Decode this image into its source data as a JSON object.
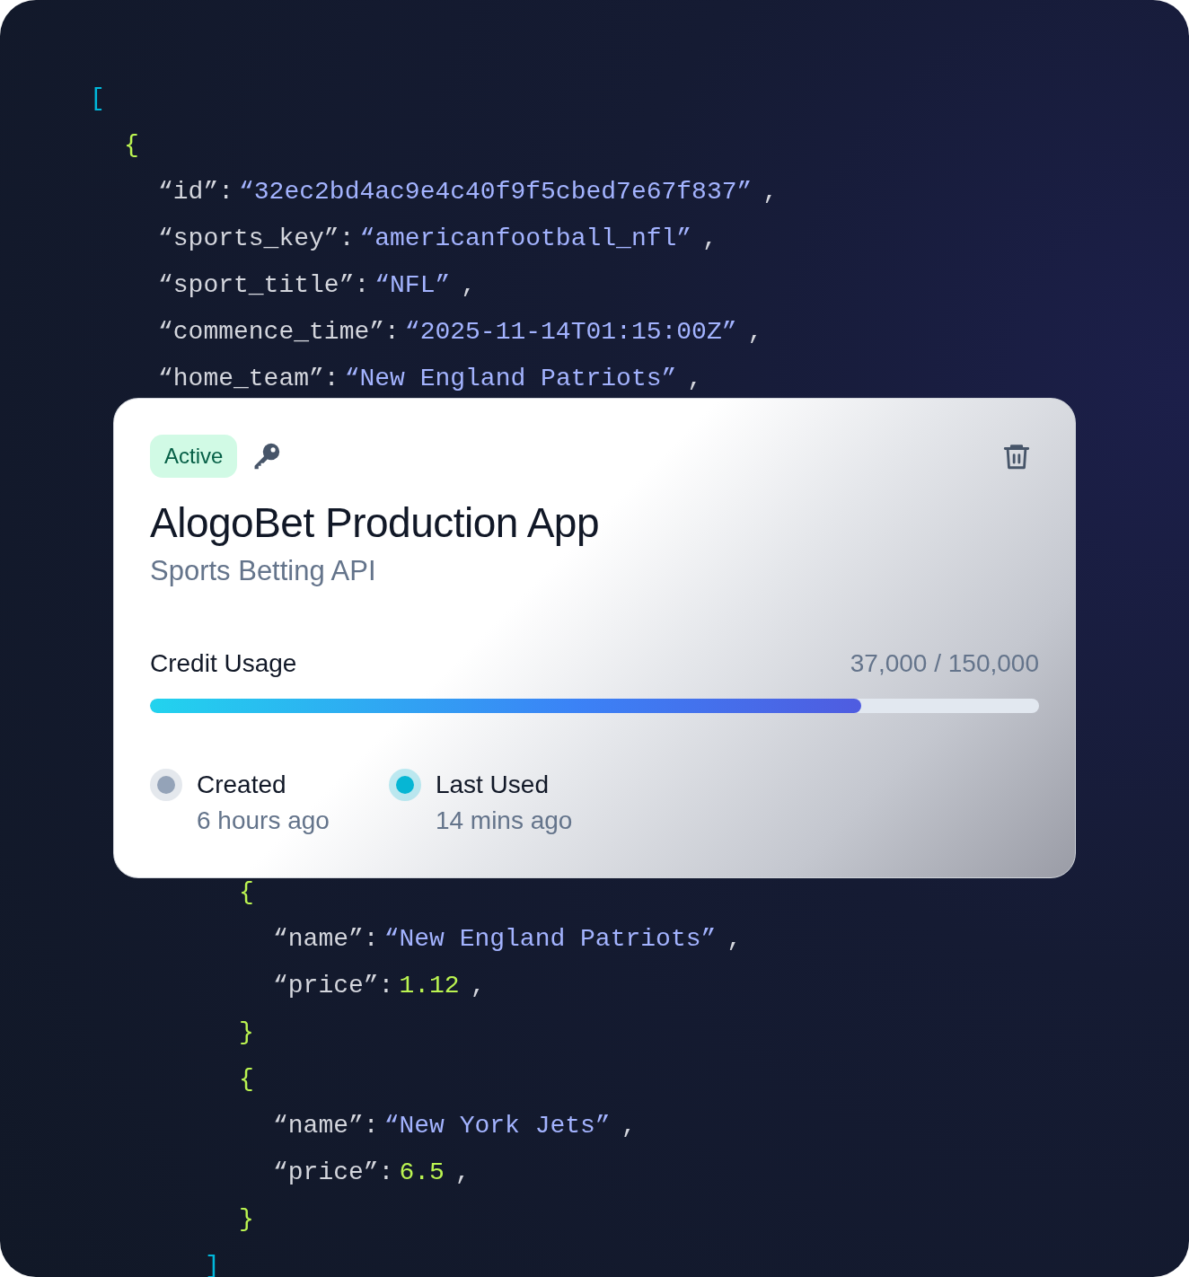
{
  "code_top": [
    {
      "kind": "open_bracket",
      "text": "["
    },
    {
      "kind": "open_brace",
      "text": "{"
    },
    {
      "kind": "field",
      "key": "“id”:",
      "value": {
        "kind": "string",
        "text": "“32ec2bd4ac9e4c40f9f5cbed7e67f837”"
      },
      "comma": ","
    },
    {
      "kind": "field",
      "key": "“sports_key”:",
      "value": {
        "kind": "string",
        "text": "“americanfootball_nfl”"
      },
      "comma": ","
    },
    {
      "kind": "field",
      "key": "“sport_title”:",
      "value": {
        "kind": "string",
        "text": "“NFL”"
      },
      "comma": ","
    },
    {
      "kind": "field",
      "key": "“commence_time”:",
      "value": {
        "kind": "string",
        "text": "“2025-11-14T01:15:00Z”"
      },
      "comma": ","
    },
    {
      "kind": "field",
      "key": "“home_team”:",
      "value": {
        "kind": "string",
        "text": "“New England Patriots”"
      },
      "comma": ","
    }
  ],
  "card": {
    "status": "Active",
    "title": "AlogoBet Production App",
    "subtitle": "Sports Betting API",
    "usage": {
      "label": "Credit Usage",
      "reading": "37,000 / 150,000",
      "level": 0.8
    },
    "times": [
      {
        "label": "Created",
        "value": "6 hours ago",
        "color": "#94a3b8"
      },
      {
        "label": "Last Used",
        "value": "14 mins ago",
        "color": "#06b6d4"
      }
    ]
  },
  "code_bottom": [
    {
      "kind": "open_brace",
      "text": "{"
    },
    {
      "kind": "field",
      "key": "“name”:",
      "value": {
        "kind": "string",
        "text": "“New England Patriots”"
      },
      "comma": ","
    },
    {
      "kind": "field",
      "key": "“price”:",
      "value": {
        "kind": "number",
        "text": "1.12"
      },
      "comma": ","
    },
    {
      "kind": "close_brace",
      "text": "}"
    },
    {
      "kind": "open_brace",
      "text": "{"
    },
    {
      "kind": "field",
      "key": "“name”:",
      "value": {
        "kind": "string",
        "text": "“New York Jets”"
      },
      "comma": ","
    },
    {
      "kind": "field",
      "key": "“price”:",
      "value": {
        "kind": "number",
        "text": "6.5"
      },
      "comma": ","
    },
    {
      "kind": "close_brace",
      "text": "}"
    },
    {
      "kind": "close_bracket",
      "text": "]"
    }
  ]
}
